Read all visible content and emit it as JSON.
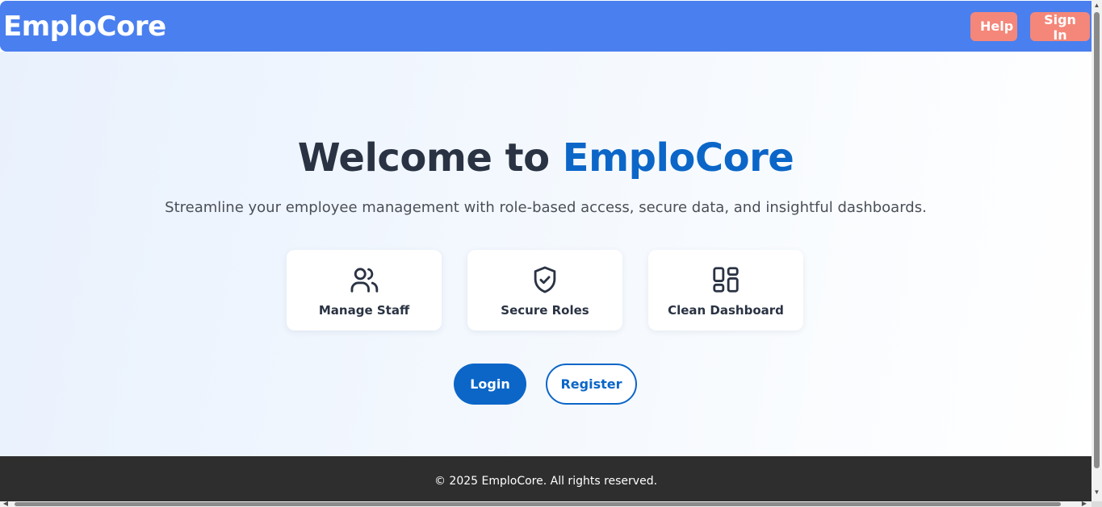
{
  "navbar": {
    "brand": "EmploCore",
    "help_label": "Help",
    "signin_label": "Sign In"
  },
  "hero": {
    "title_prefix": "Welcome to ",
    "title_accent": "EmploCore",
    "subtitle": "Streamline your employee management with role-based access, secure data, and insightful dashboards."
  },
  "features": [
    {
      "icon": "users-icon",
      "label": "Manage Staff"
    },
    {
      "icon": "shield-check-icon",
      "label": "Secure Roles"
    },
    {
      "icon": "dashboard-grid-icon",
      "label": "Clean Dashboard"
    }
  ],
  "cta": {
    "login_label": "Login",
    "register_label": "Register"
  },
  "footer": {
    "text": "© 2025 EmploCore. All rights reserved."
  },
  "colors": {
    "navbar": "#4a7fef",
    "nav_button": "#f4877a",
    "accent": "#0b66c8",
    "heading": "#2a3343",
    "footer": "#2e2e2e"
  }
}
